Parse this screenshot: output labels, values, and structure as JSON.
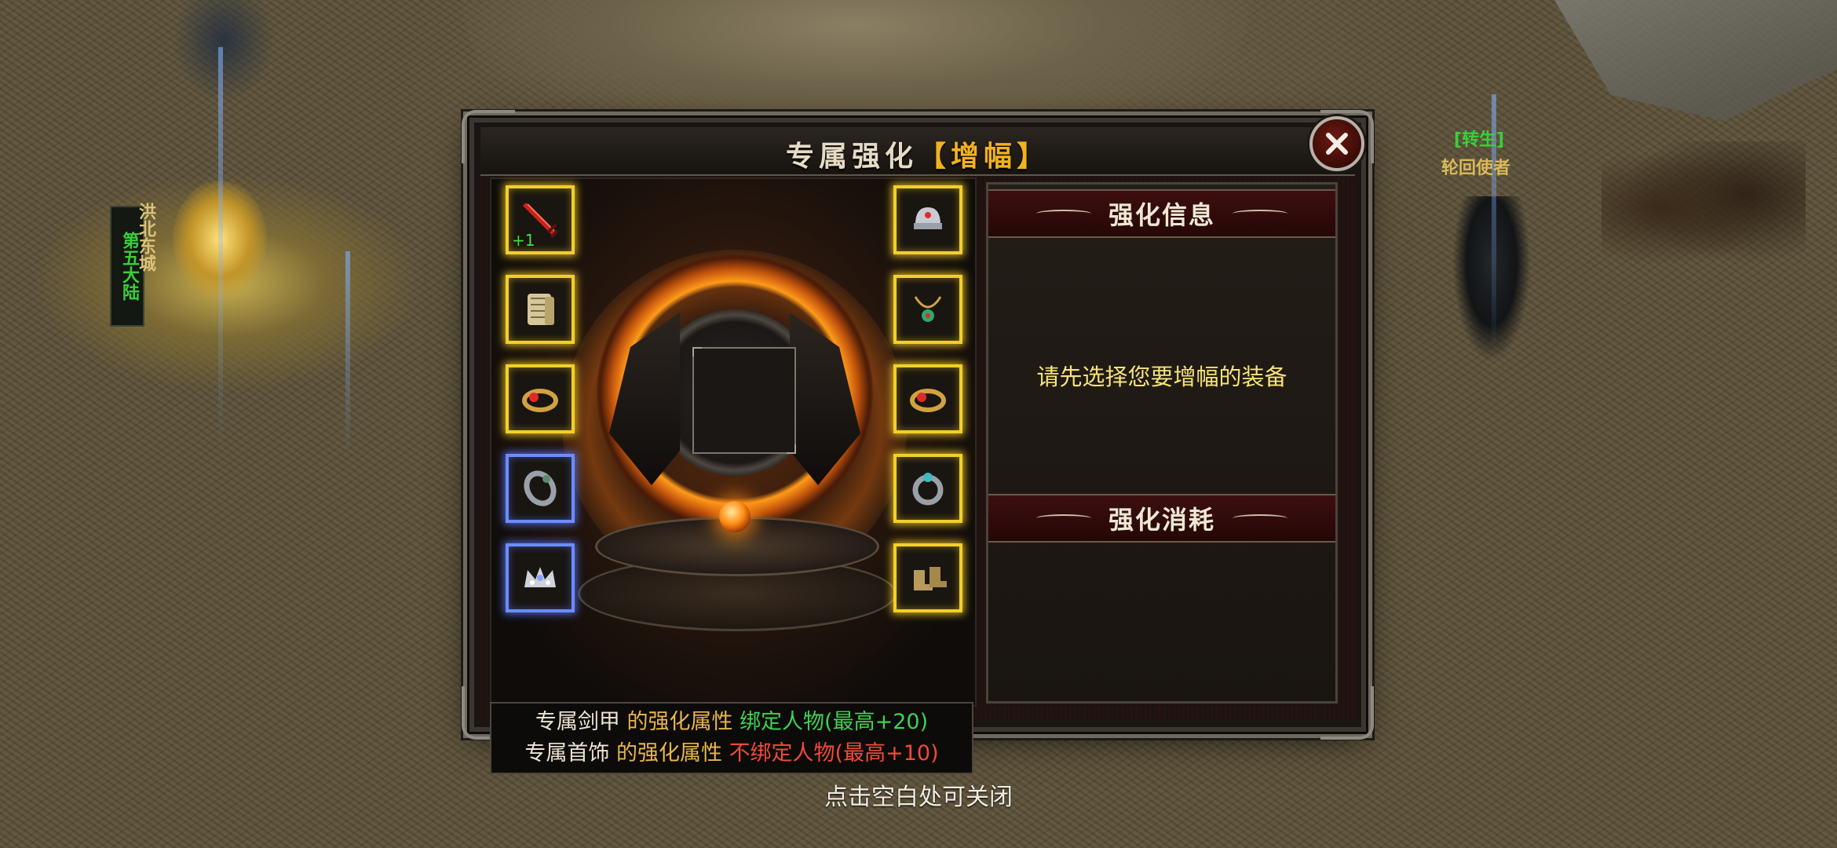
{
  "panel": {
    "title_main": "专属强化",
    "title_sub": "增幅",
    "title_bracket_left": "【",
    "title_bracket_right": "】"
  },
  "slots": {
    "left": [
      {
        "item": "sword-icon",
        "tier": "gold",
        "enhance_level": "+1"
      },
      {
        "item": "scroll-armor-icon",
        "tier": "gold"
      },
      {
        "item": "red-gem-bracelet-icon",
        "tier": "gold"
      },
      {
        "item": "ring-icon",
        "tier": "blue"
      },
      {
        "item": "jeweled-crown-icon",
        "tier": "blue"
      }
    ],
    "right": [
      {
        "item": "helmet-icon",
        "tier": "gold"
      },
      {
        "item": "necklace-icon",
        "tier": "gold"
      },
      {
        "item": "red-gem-bracelet-icon",
        "tier": "gold"
      },
      {
        "item": "ring-icon",
        "tier": "gold"
      },
      {
        "item": "boots-icon",
        "tier": "gold"
      }
    ]
  },
  "info_strip": {
    "line1": {
      "a": "专属剑甲",
      "b": "的强化属性",
      "c": "绑定人物(最高+20)"
    },
    "line2": {
      "a": "专属首饰",
      "b": "的强化属性",
      "c": "不绑定人物(最高+10)"
    }
  },
  "right_panel": {
    "info_header": "强化信息",
    "hint": "请先选择您要增幅的装备",
    "cost_header": "强化消耗"
  },
  "background": {
    "side_banner_green": "第五大陆",
    "side_banner_gold": "洪北东城",
    "npc_label": "[转生]",
    "npc_name": "轮回使者"
  },
  "close_tip": "点击空白处可关闭",
  "colors": {
    "slot_gold": "#f2cf2a",
    "slot_blue": "#6b8cff",
    "hint_yellow": "#f6e37a",
    "green": "#3fd24d",
    "red": "#f24a39",
    "gold_text": "#e9b54a"
  }
}
